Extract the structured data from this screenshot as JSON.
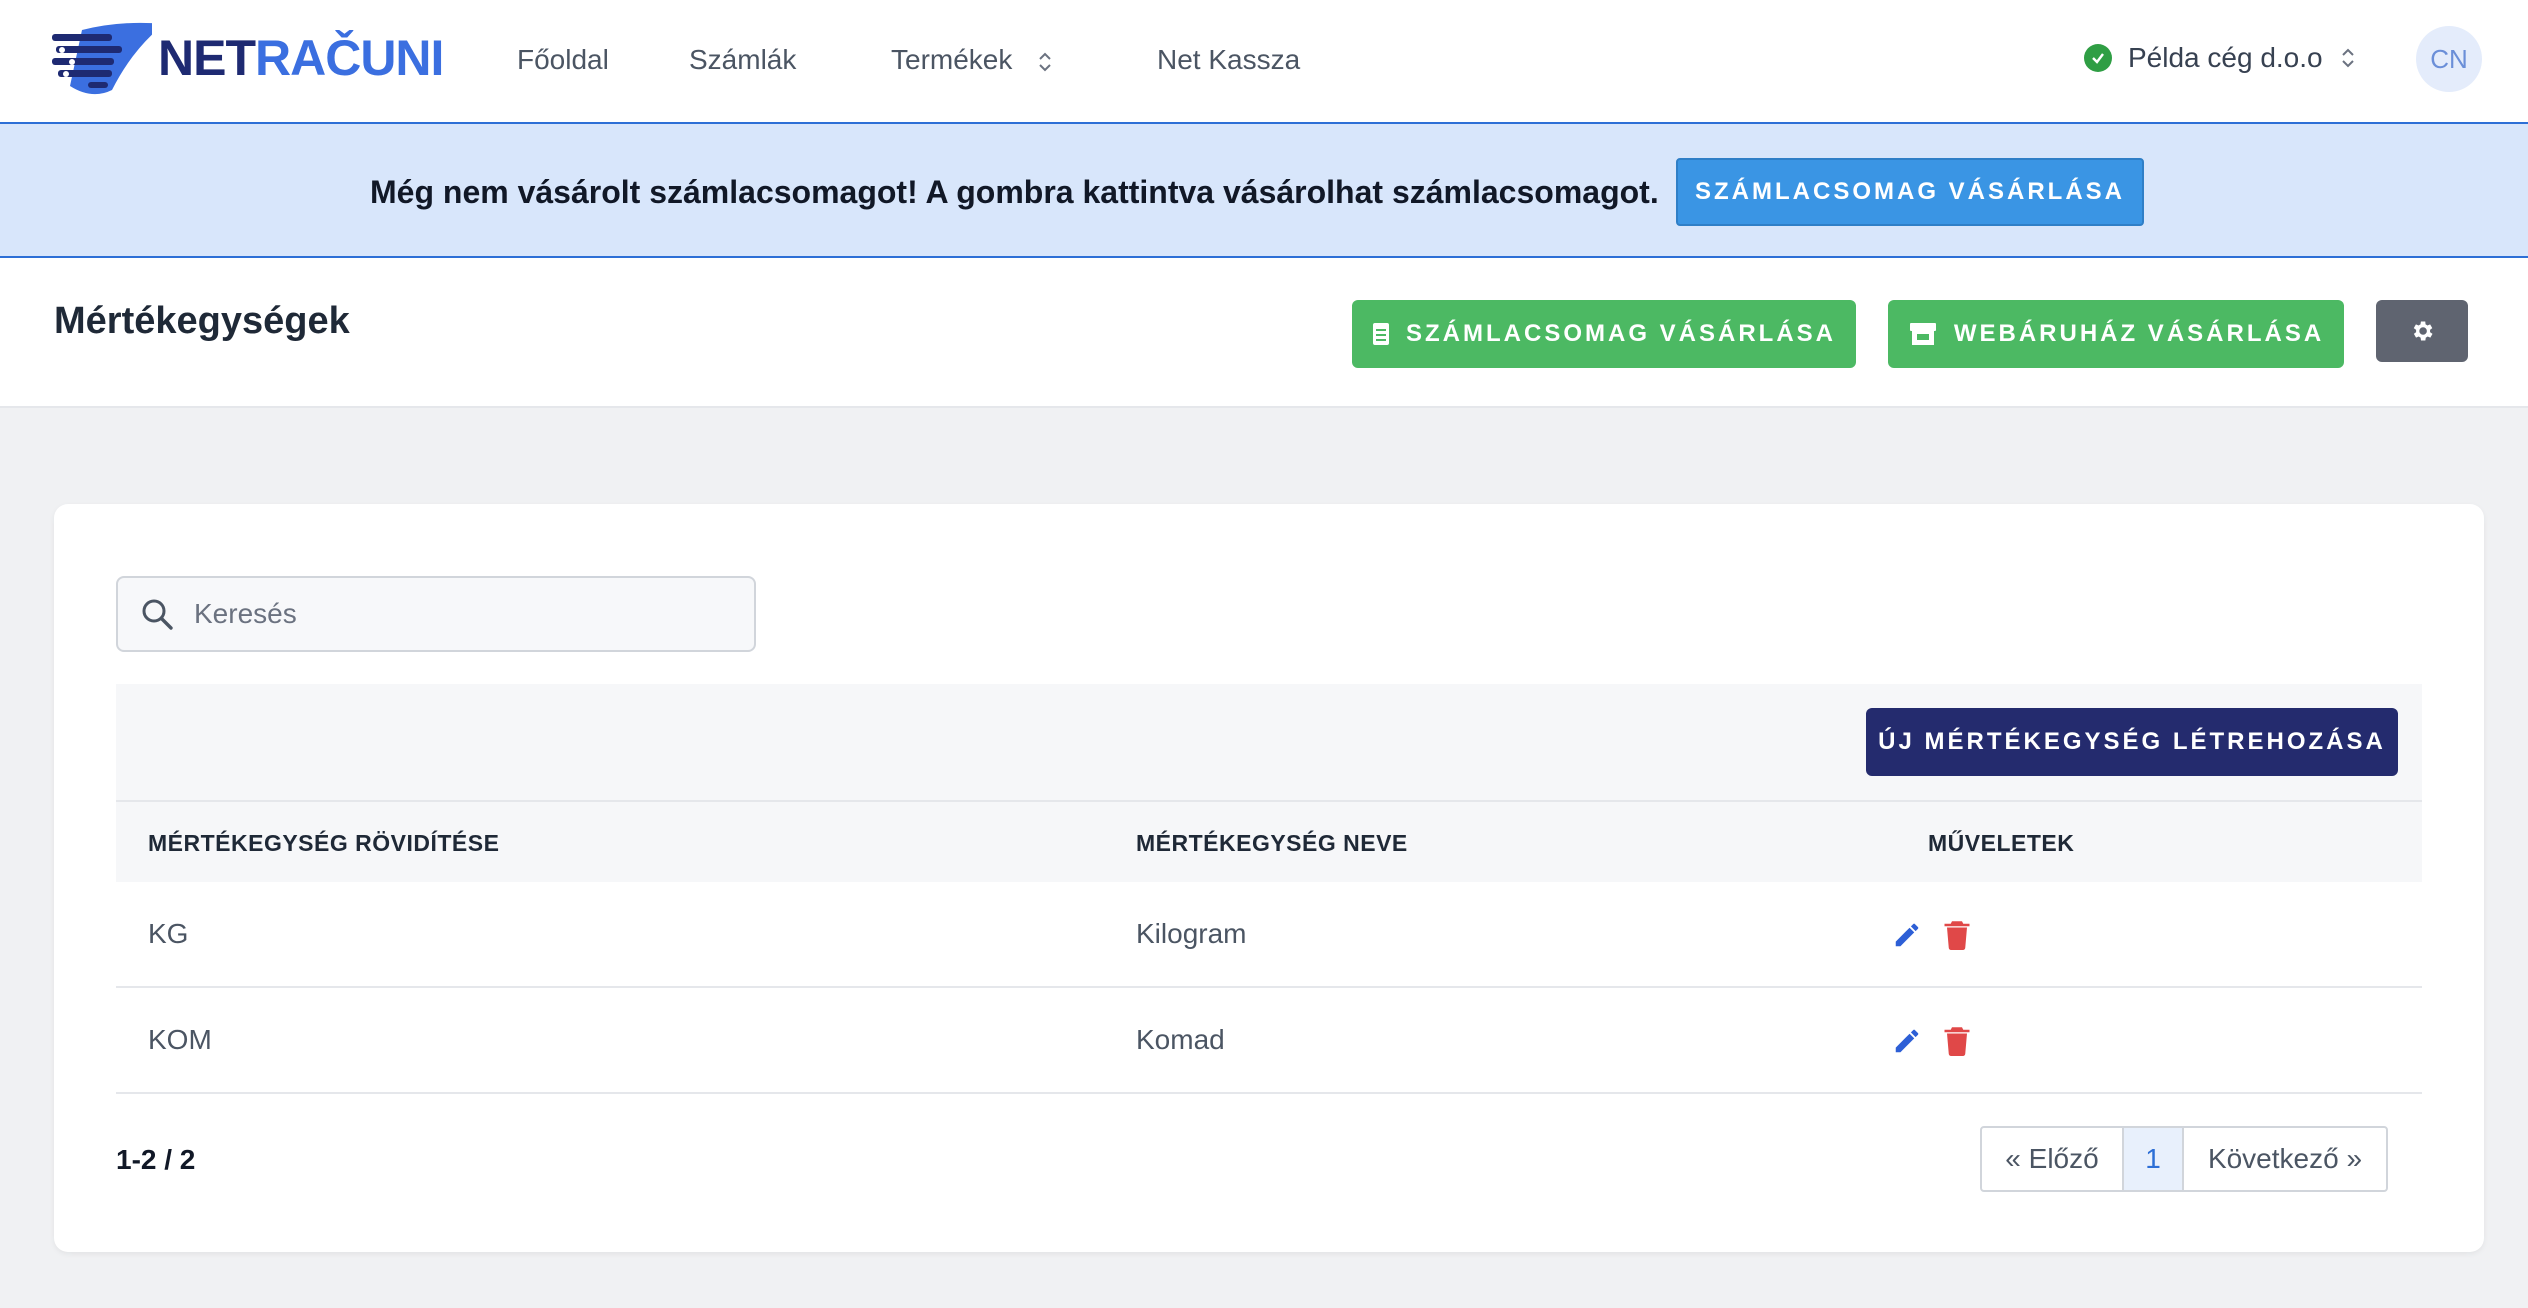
{
  "brand": {
    "part1": "NET",
    "part2": "RAČUNI",
    "accent": "#3b6fe0",
    "dark": "#1e2a72"
  },
  "nav": {
    "items": [
      {
        "label": "Főoldal"
      },
      {
        "label": "Számlák"
      },
      {
        "label": "Termékek"
      },
      {
        "label": "Net Kassza"
      }
    ],
    "company": "Példa cég d.o.o",
    "avatar": "CN"
  },
  "banner": {
    "text": "Még nem vásárolt számlacsomagot! A gombra kattintva vásárolhat számlacsomagot.",
    "button": "SZÁMLACSOMAG VÁSÁRLÁSA"
  },
  "header": {
    "title": "Mértékegységek",
    "buy_invoices": "SZÁMLACSOMAG VÁSÁRLÁSA",
    "buy_webshop": "WEBÁRUHÁZ VÁSÁRLÁSA",
    "settings_icon": "gear-icon"
  },
  "search": {
    "placeholder": "Keresés",
    "value": ""
  },
  "table": {
    "new_button": "ÚJ MÉRTÉKEGYSÉG LÉTREHOZÁSA",
    "columns": [
      "MÉRTÉKEGYSÉG RÖVIDÍTÉSE",
      "MÉRTÉKEGYSÉG NEVE",
      "MŰVELETEK"
    ],
    "rows": [
      {
        "abbr": "KG",
        "name": "Kilogram"
      },
      {
        "abbr": "KOM",
        "name": "Komad"
      }
    ]
  },
  "pagination": {
    "range": "1-2 / 2",
    "prev": "« Előző",
    "current": "1",
    "next": "Következő »"
  },
  "colors": {
    "green": "#4cb963",
    "navy": "#242b6e",
    "blue": "#3a95e4",
    "edit": "#2d5fd6",
    "delete": "#e04848"
  }
}
